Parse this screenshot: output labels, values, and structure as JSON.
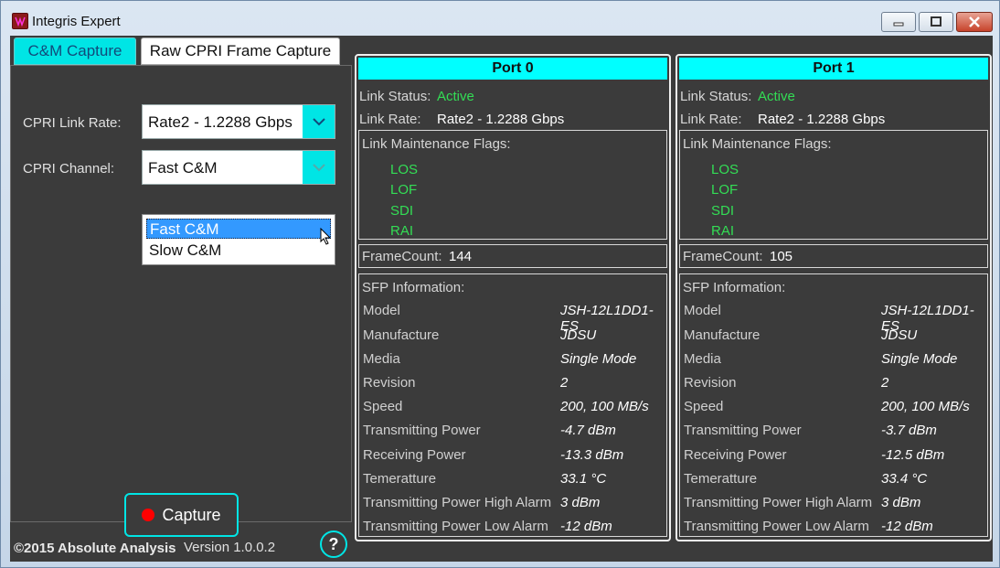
{
  "window": {
    "title": "Integris Expert"
  },
  "tabs": [
    {
      "label": "C&M Capture",
      "active": true
    },
    {
      "label": "Raw CPRI Frame Capture",
      "active": false
    }
  ],
  "left_panel": {
    "link_rate_label": "CPRI Link Rate:",
    "link_rate_value": "Rate2 - 1.2288 Gbps",
    "channel_label": "CPRI Channel:",
    "channel_value": "Fast C&M",
    "channel_options": [
      "Fast C&M",
      "Slow C&M"
    ],
    "capture_label": "Capture"
  },
  "footer": {
    "copyright": "©2015 Absolute Analysis",
    "version": "Version 1.0.0.2",
    "help_label": "?"
  },
  "common_labels": {
    "link_status": "Link Status:",
    "link_rate": "Link Rate:",
    "maint_flags": "Link Maintenance Flags:",
    "frame_count": "FrameCount:",
    "sfp_info": "SFP Information:"
  },
  "ports": [
    {
      "title": "Port 0",
      "link_status": "Active",
      "link_rate": "Rate2 - 1.2288 Gbps",
      "flags": [
        "LOS",
        "LOF",
        "SDI",
        "RAI"
      ],
      "frame_count": "144",
      "sfp": [
        {
          "k": "Model",
          "v": "JSH-12L1DD1-ES"
        },
        {
          "k": "Manufacture",
          "v": "JDSU"
        },
        {
          "k": "Media",
          "v": "Single Mode"
        },
        {
          "k": "Revision",
          "v": "2"
        },
        {
          "k": "Speed",
          "v": "200, 100 MB/s"
        },
        {
          "k": "Transmitting Power",
          "v": "-4.7 dBm"
        },
        {
          "k": "Receiving Power",
          "v": "-13.3 dBm"
        },
        {
          "k": "Temeratture",
          "v": "33.1 °C"
        },
        {
          "k": "Transmitting Power High Alarm",
          "v": "3 dBm"
        },
        {
          "k": "Transmitting Power Low Alarm",
          "v": "-12 dBm"
        }
      ]
    },
    {
      "title": "Port 1",
      "link_status": "Active",
      "link_rate": "Rate2 - 1.2288 Gbps",
      "flags": [
        "LOS",
        "LOF",
        "SDI",
        "RAI"
      ],
      "frame_count": "105",
      "sfp": [
        {
          "k": "Model",
          "v": "JSH-12L1DD1-ES"
        },
        {
          "k": "Manufacture",
          "v": "JDSU"
        },
        {
          "k": "Media",
          "v": "Single Mode"
        },
        {
          "k": "Revision",
          "v": "2"
        },
        {
          "k": "Speed",
          "v": "200, 100 MB/s"
        },
        {
          "k": "Transmitting Power",
          "v": "-3.7 dBm"
        },
        {
          "k": "Receiving Power",
          "v": "-12.5 dBm"
        },
        {
          "k": "Temeratture",
          "v": "33.4 °C"
        },
        {
          "k": "Transmitting Power High Alarm",
          "v": "3 dBm"
        },
        {
          "k": "Transmitting Power Low Alarm",
          "v": "-12 dBm"
        }
      ]
    }
  ],
  "colors": {
    "accent": "#00e5e5",
    "port_header": "#00ffff",
    "status_green": "#33dd55",
    "panel_bg": "#3b3b3b"
  }
}
